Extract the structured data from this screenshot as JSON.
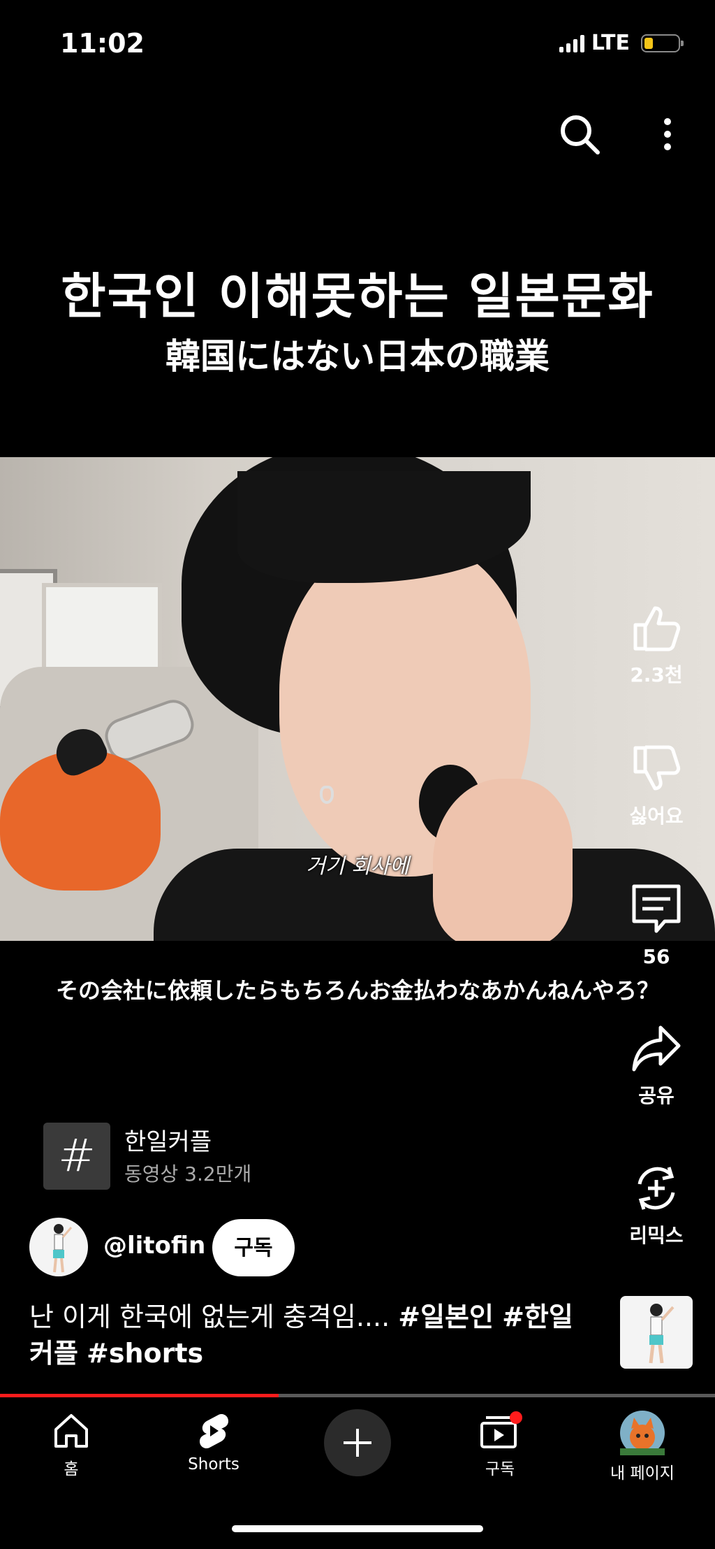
{
  "status_bar": {
    "time": "11:02",
    "network": "LTE",
    "battery_level": 0.25,
    "battery_color": "#f5c518"
  },
  "top_actions": {
    "search_icon": "search-icon",
    "more_icon": "more-vertical-icon"
  },
  "video": {
    "title_ko": "한국인 이해못하는 일본문화",
    "title_ja": "韓国にはない日本の職業",
    "caption": "거기 회사에",
    "subtitle": "その会社に依頼したらもちろんお金払わなあかんねんやろ？"
  },
  "actions": {
    "like": {
      "icon": "thumbs-up-icon",
      "label": "2.3천"
    },
    "dislike": {
      "icon": "thumbs-down-icon",
      "label": "싫어요"
    },
    "comments": {
      "icon": "comment-icon",
      "label": "56"
    },
    "share": {
      "icon": "share-icon",
      "label": "공유"
    },
    "remix": {
      "icon": "remix-icon",
      "label": "리믹스"
    }
  },
  "hashtag": {
    "symbol": "#",
    "name": "한일커플",
    "count": "동영상 3.2만개"
  },
  "channel": {
    "handle": "@litofin",
    "subscribe_label": "구독"
  },
  "description": {
    "text": "난 이게 한국에 없는게 충격임....",
    "tags": [
      "#일본인",
      "#한일",
      "커플",
      "#shorts"
    ]
  },
  "progress": {
    "fraction": 0.39,
    "fill_color": "#ff1c1c"
  },
  "bottom_nav": {
    "home": {
      "icon": "home-icon",
      "label": "홈"
    },
    "shorts": {
      "icon": "shorts-icon",
      "label": "Shorts"
    },
    "create": {
      "icon": "plus-icon"
    },
    "subscriptions": {
      "icon": "subscriptions-icon",
      "label": "구독"
    },
    "profile": {
      "icon": "avatar",
      "label": "내 페이지"
    }
  }
}
